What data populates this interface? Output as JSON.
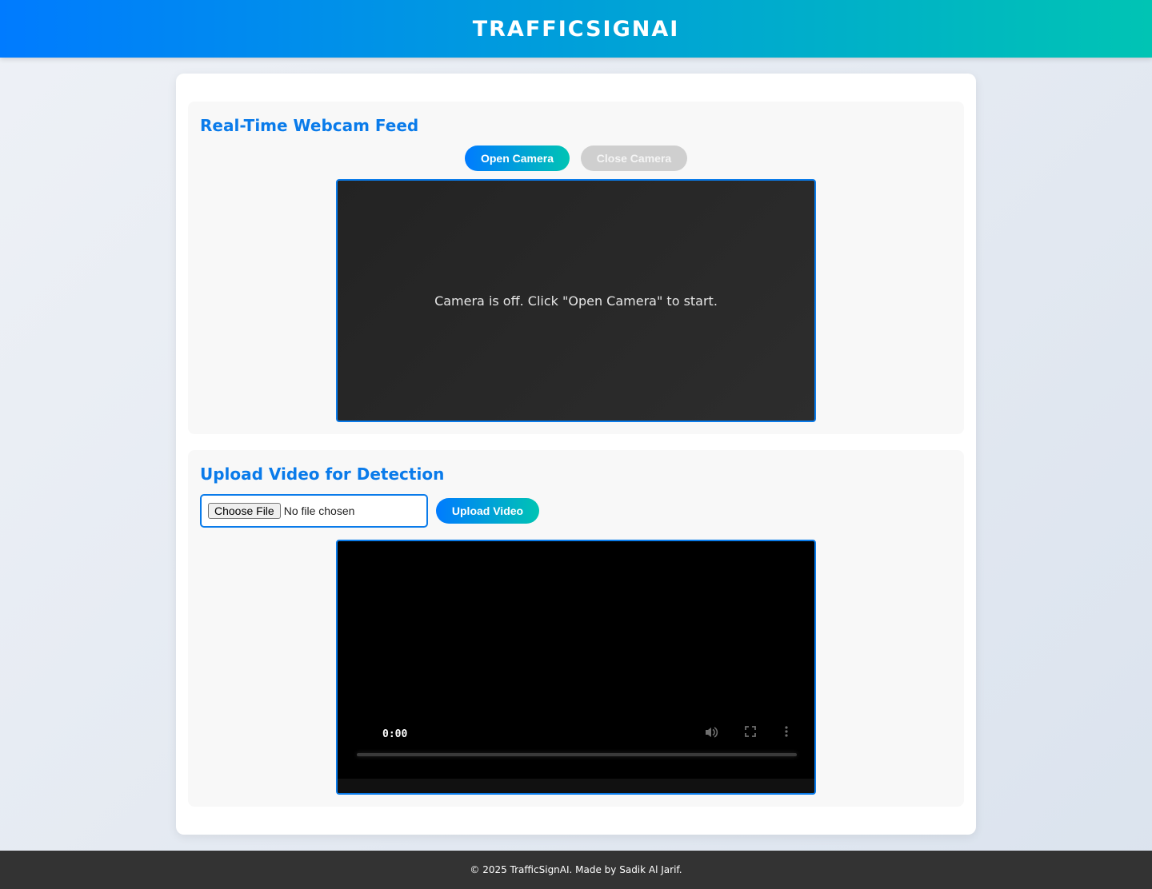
{
  "header": {
    "title": "TRAFFICSIGNAI"
  },
  "webcam": {
    "title": "Real-Time Webcam Feed",
    "open_label": "Open Camera",
    "close_label": "Close Camera",
    "status_message": "Camera is off. Click \"Open Camera\" to start."
  },
  "upload": {
    "title": "Upload Video for Detection",
    "choose_file_label": "Choose File",
    "file_status": "No file chosen",
    "upload_label": "Upload Video",
    "video": {
      "current_time": "0:00",
      "icons": [
        "volume-icon",
        "fullscreen-icon",
        "more-options-icon"
      ]
    }
  },
  "footer": {
    "text": "© 2025 TrafficSignAI. Made by Sadik Al Jarif."
  },
  "colors": {
    "accent": "#0a7bea",
    "gradient_start": "#007bff",
    "gradient_end": "#00c4b4",
    "footer_bg": "#333333"
  }
}
